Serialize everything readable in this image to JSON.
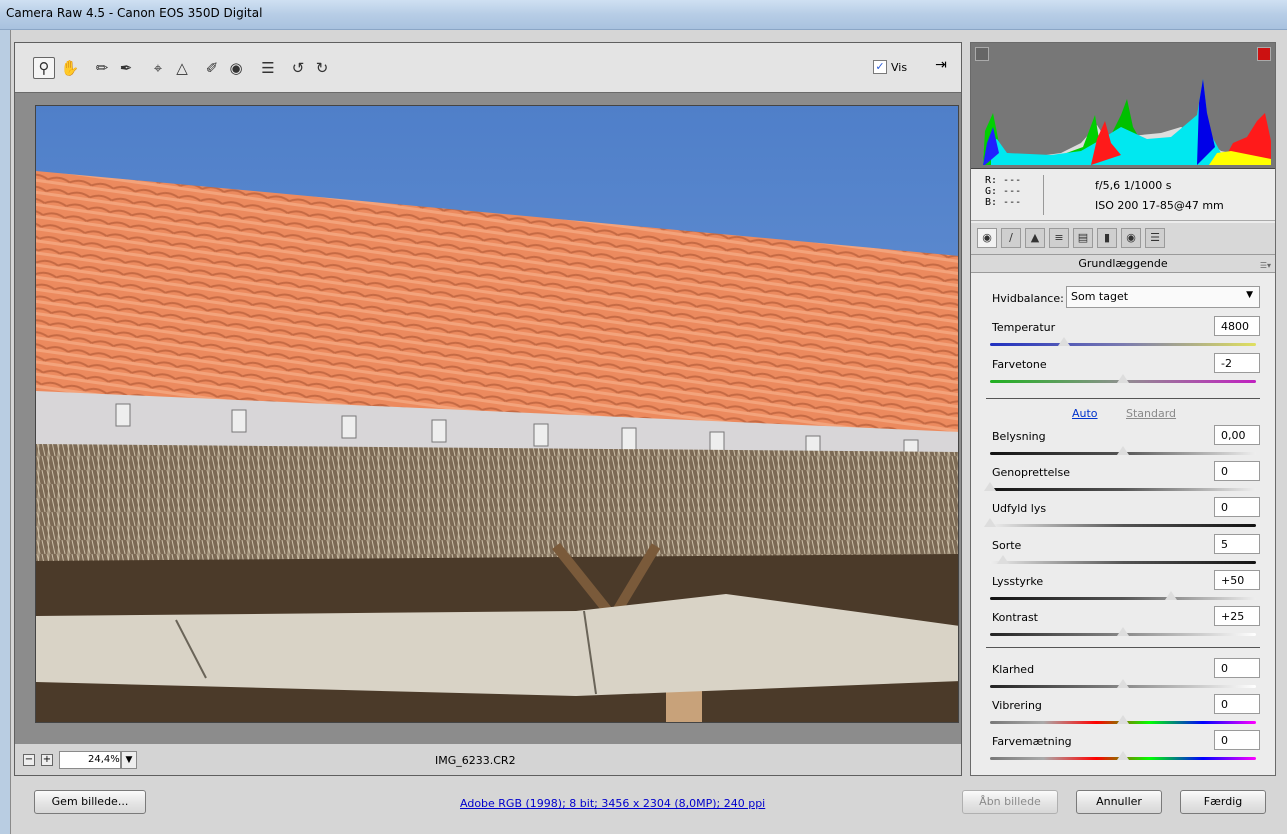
{
  "window": {
    "title": "Camera Raw 4.5  -  Canon EOS 350D Digital"
  },
  "toolbar": {
    "tools": [
      {
        "icon": "zoom-icon"
      },
      {
        "icon": "hand-icon"
      },
      {
        "icon": "white-balance-icon"
      },
      {
        "icon": "color-sampler-icon"
      },
      {
        "icon": "crop-icon"
      },
      {
        "icon": "straighten-icon"
      },
      {
        "icon": "retouch-icon"
      },
      {
        "icon": "red-eye-icon"
      },
      {
        "icon": "preferences-icon"
      },
      {
        "icon": "rotate-ccw-icon"
      },
      {
        "icon": "rotate-cw-icon"
      }
    ],
    "preview_label": "Vis",
    "preview_checked": true
  },
  "preview": {
    "zoom": "24,4%",
    "filename": "IMG_6233.CR2"
  },
  "info": {
    "r": "R:  ---",
    "g": "G:  ---",
    "b": "B:  ---",
    "aperture_shutter": "f/5,6   1/1000 s",
    "iso_lens": "ISO 200   17-85@47 mm"
  },
  "panel": {
    "title": "Grundlæggende",
    "wb_label": "Hvidbalance:",
    "wb_value": "Som taget",
    "auto_label": "Auto",
    "standard_label": "Standard",
    "sliders": [
      {
        "label": "Temperatur",
        "value": "4800",
        "pos": 0.28,
        "track": "temp"
      },
      {
        "label": "Farvetone",
        "value": "-2",
        "pos": 0.5,
        "track": "tint"
      },
      {
        "label": "Belysning",
        "value": "0,00",
        "pos": 0.5,
        "track": "gray"
      },
      {
        "label": "Genoprettelse",
        "value": "0",
        "pos": 0.0,
        "track": "gray"
      },
      {
        "label": "Udfyld lys",
        "value": "0",
        "pos": 0.0,
        "track": "grayrev"
      },
      {
        "label": "Sorte",
        "value": "5",
        "pos": 0.05,
        "track": "grayrev"
      },
      {
        "label": "Lysstyrke",
        "value": "+50",
        "pos": 0.68,
        "track": "gray"
      },
      {
        "label": "Kontrast",
        "value": "+25",
        "pos": 0.5,
        "track": "contrast"
      },
      {
        "label": "Klarhed",
        "value": "0",
        "pos": 0.5,
        "track": "contrast"
      },
      {
        "label": "Vibrering",
        "value": "0",
        "pos": 0.5,
        "track": "sat"
      },
      {
        "label": "Farvemætning",
        "value": "0",
        "pos": 0.5,
        "track": "sat"
      }
    ]
  },
  "footer": {
    "save": "Gem billede...",
    "workflow": "Adobe RGB (1998); 8 bit; 3456 x 2304 (8,0MP); 240 ppi",
    "open": "Åbn billede",
    "cancel": "Annuller",
    "done": "Færdig"
  }
}
